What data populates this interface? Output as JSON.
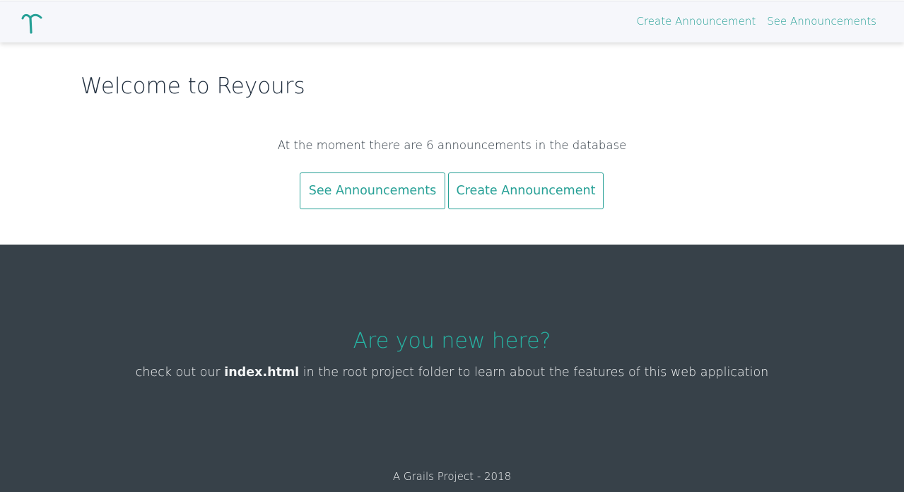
{
  "nav": {
    "logo_icon": "grails-logo-icon",
    "links": [
      {
        "label": "Create Announcement"
      },
      {
        "label": "See Announcements"
      }
    ]
  },
  "main": {
    "title": "Welcome to Reyours",
    "count_text": "At the moment there are 6 announcements in the database",
    "announcement_count": 6,
    "buttons": {
      "see_label": "See Announcements",
      "create_label": "Create Announcement"
    }
  },
  "footer": {
    "heading": "Are you new here?",
    "line_before": "check out our ",
    "line_bold": "index.html",
    "line_after": " in the root project folder to learn about the features of this web application",
    "copyright": "A Grails Project - 2018"
  },
  "colors": {
    "accent": "#26a096",
    "footer_bg": "#374149",
    "footer_heading": "#26b3a3",
    "nav_bg": "#f6f7fb"
  }
}
